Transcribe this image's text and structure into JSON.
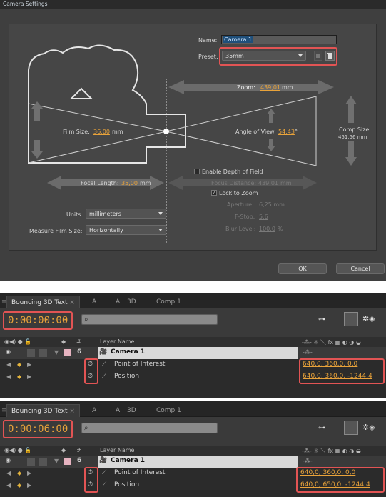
{
  "dialog": {
    "title": "Camera Settings",
    "name_label": "Name:",
    "name_value": "Camera 1",
    "preset_label": "Preset:",
    "preset_value": "35mm",
    "zoom_label": "Zoom:",
    "zoom_value": "439,01",
    "zoom_unit": "mm",
    "film_size_label": "Film Size:",
    "film_size_value": "36,00",
    "film_size_unit": "mm",
    "angle_label": "Angle of View:",
    "angle_value": "54,43",
    "angle_unit": "°",
    "comp_size_label": "Comp Size",
    "comp_size_value": "451,56 mm",
    "focal_length_label": "Focal Length:",
    "focal_length_value": "35,00",
    "focal_length_unit": "mm",
    "enable_dof_label": "Enable Depth of Field",
    "focus_distance_label": "Focus Distance:",
    "focus_distance_value": "439,01",
    "focus_distance_unit": "mm",
    "lock_to_zoom_label": "Lock to Zoom",
    "aperture_label": "Aperture:",
    "aperture_value": "6,25 mm",
    "fstop_label": "F-Stop:",
    "fstop_value": "5,6",
    "blur_label": "Blur Level:",
    "blur_value": "100,0",
    "blur_unit": "%",
    "units_label": "Units:",
    "units_value": "millimeters",
    "measure_label": "Measure Film Size:",
    "measure_value": "Horizontally",
    "ok_label": "OK",
    "cancel_label": "Cancel"
  },
  "panels": [
    {
      "tabs": [
        "Bouncing 3D Text",
        "A",
        "A",
        "3D",
        "Comp 1"
      ],
      "timecode": "0:00:00:00",
      "col_num": "#",
      "col_layer": "Layer Name",
      "layer_num": "6",
      "layer_name": "Camera 1",
      "props": [
        {
          "name": "Point of Interest",
          "value": "640,0, 360,0, 0,0"
        },
        {
          "name": "Position",
          "value": "640,0, 360,0, -1244,4"
        }
      ]
    },
    {
      "tabs": [
        "Bouncing 3D Text",
        "A",
        "A",
        "3D",
        "Comp 1"
      ],
      "timecode": "0:00:06:00",
      "col_num": "#",
      "col_layer": "Layer Name",
      "layer_num": "6",
      "layer_name": "Camera 1",
      "props": [
        {
          "name": "Point of Interest",
          "value": "640,0, 360,0, 0,0"
        },
        {
          "name": "Position",
          "value": "640,0, 650,0, -1244,4"
        }
      ]
    }
  ],
  "colors": {
    "accent": "#e9a33a",
    "highlight_box": "#e25454"
  }
}
